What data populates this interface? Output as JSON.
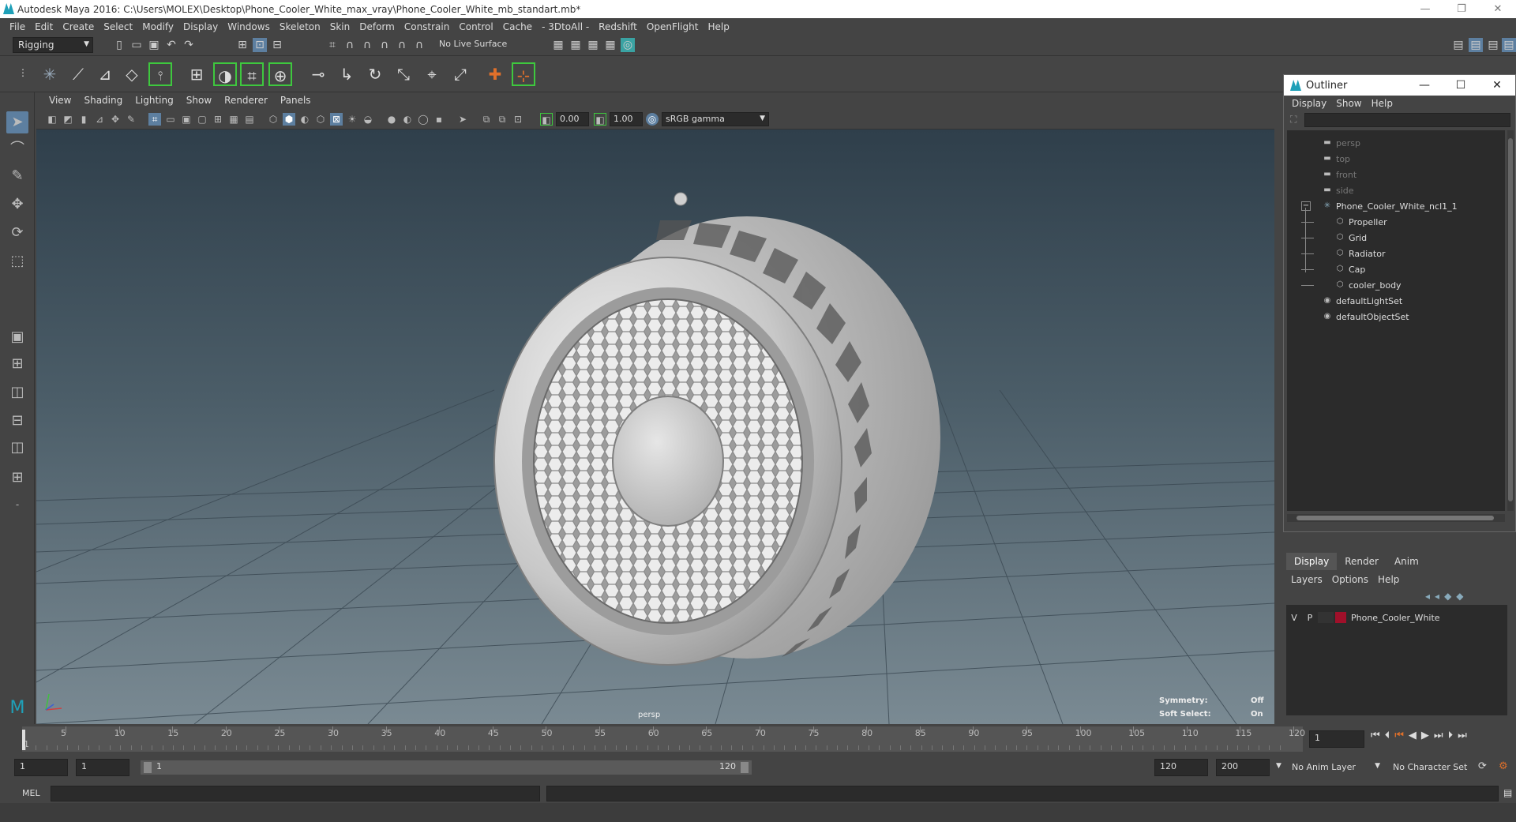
{
  "window": {
    "title": "Autodesk Maya 2016: C:\\Users\\MOLEX\\Desktop\\Phone_Cooler_White_max_vray\\Phone_Cooler_White_mb_standart.mb*",
    "minimize": "—",
    "restore": "❐",
    "close": "✕"
  },
  "menu": [
    "File",
    "Edit",
    "Create",
    "Select",
    "Modify",
    "Display",
    "Windows",
    "Skeleton",
    "Skin",
    "Deform",
    "Constrain",
    "Control",
    "Cache",
    "- 3DtoAll -",
    "Redshift",
    "OpenFlight",
    "Help"
  ],
  "status": {
    "mode": "Rigging",
    "live_surface": "No Live Surface"
  },
  "panel": {
    "menu": [
      "View",
      "Shading",
      "Lighting",
      "Show",
      "Renderer",
      "Panels"
    ],
    "exposure": "0.00",
    "gamma": "1.00",
    "colorspace": "sRGB gamma"
  },
  "viewport": {
    "camera_label": "persp",
    "hud": {
      "symmetry_label": "Symmetry:",
      "symmetry_value": "Off",
      "soft_select_label": "Soft Select:",
      "soft_select_value": "On"
    }
  },
  "outliner": {
    "title": "Outliner",
    "menu": [
      "Display",
      "Show",
      "Help"
    ],
    "items": [
      {
        "label": "persp",
        "icon": "camera-icon",
        "indent": 0,
        "dim": true
      },
      {
        "label": "top",
        "icon": "camera-icon",
        "indent": 0,
        "dim": true
      },
      {
        "label": "front",
        "icon": "camera-icon",
        "indent": 0,
        "dim": true
      },
      {
        "label": "side",
        "icon": "camera-icon",
        "indent": 0,
        "dim": true
      },
      {
        "label": "Phone_Cooler_White_ncl1_1",
        "icon": "group-icon",
        "indent": 0,
        "dim": false,
        "expander": "−"
      },
      {
        "label": "Propeller",
        "icon": "mesh-icon",
        "indent": 1,
        "dim": false
      },
      {
        "label": "Grid",
        "icon": "mesh-icon",
        "indent": 1,
        "dim": false
      },
      {
        "label": "Radiator",
        "icon": "mesh-icon",
        "indent": 1,
        "dim": false
      },
      {
        "label": "Cap",
        "icon": "mesh-icon",
        "indent": 1,
        "dim": false
      },
      {
        "label": "cooler_body",
        "icon": "mesh-icon",
        "indent": 1,
        "dim": false
      },
      {
        "label": "defaultLightSet",
        "icon": "set-icon",
        "indent": 0,
        "dim": false
      },
      {
        "label": "defaultObjectSet",
        "icon": "set-icon",
        "indent": 0,
        "dim": false
      }
    ]
  },
  "layers": {
    "tabs": [
      "Display",
      "Render",
      "Anim"
    ],
    "menu": [
      "Layers",
      "Options",
      "Help"
    ],
    "layer": {
      "v": "V",
      "p": "P",
      "name": "Phone_Cooler_White",
      "color": "#a0102a"
    }
  },
  "timeline": {
    "ticks": [
      "5",
      "10",
      "15",
      "20",
      "25",
      "30",
      "35",
      "40",
      "45",
      "50",
      "55",
      "60",
      "65",
      "70",
      "75",
      "80",
      "85",
      "90",
      "95",
      "100",
      "105",
      "110",
      "115",
      "120"
    ],
    "first_tick": "1",
    "current_frame": "1"
  },
  "range": {
    "start": "1",
    "playback_start": "1",
    "slider_start": "1",
    "slider_end": "120",
    "playback_end": "120",
    "end": "200",
    "anim_layer": "No Anim Layer",
    "character_set": "No Character Set"
  },
  "mel": {
    "label": "MEL"
  }
}
